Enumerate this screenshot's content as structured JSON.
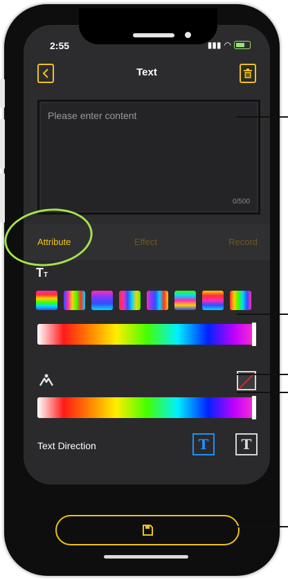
{
  "statusbar": {
    "time": "2:55"
  },
  "navbar": {
    "title": "Text",
    "back_icon": "chevron-left-icon",
    "trash_icon": "trash-icon"
  },
  "editor": {
    "placeholder": "Please enter content",
    "counter": "0/500"
  },
  "tabs": [
    {
      "label": "Attribute",
      "active": true
    },
    {
      "label": "Effect",
      "active": false
    },
    {
      "label": "Record",
      "active": false
    }
  ],
  "attribute": {
    "font_icon_big": "T",
    "font_icon_small": "T",
    "swatch_count": 8,
    "outline_icon": "outline-person-icon",
    "no_color_icon": "no-color-icon"
  },
  "direction": {
    "label": "Text Direction",
    "horizontal_glyph": "T",
    "vertical_glyph": "T",
    "selected": "horizontal"
  },
  "colors": {
    "accent": "#f0c419",
    "selected_blue": "#1e90ff",
    "annotation_green": "#a3e44a"
  }
}
